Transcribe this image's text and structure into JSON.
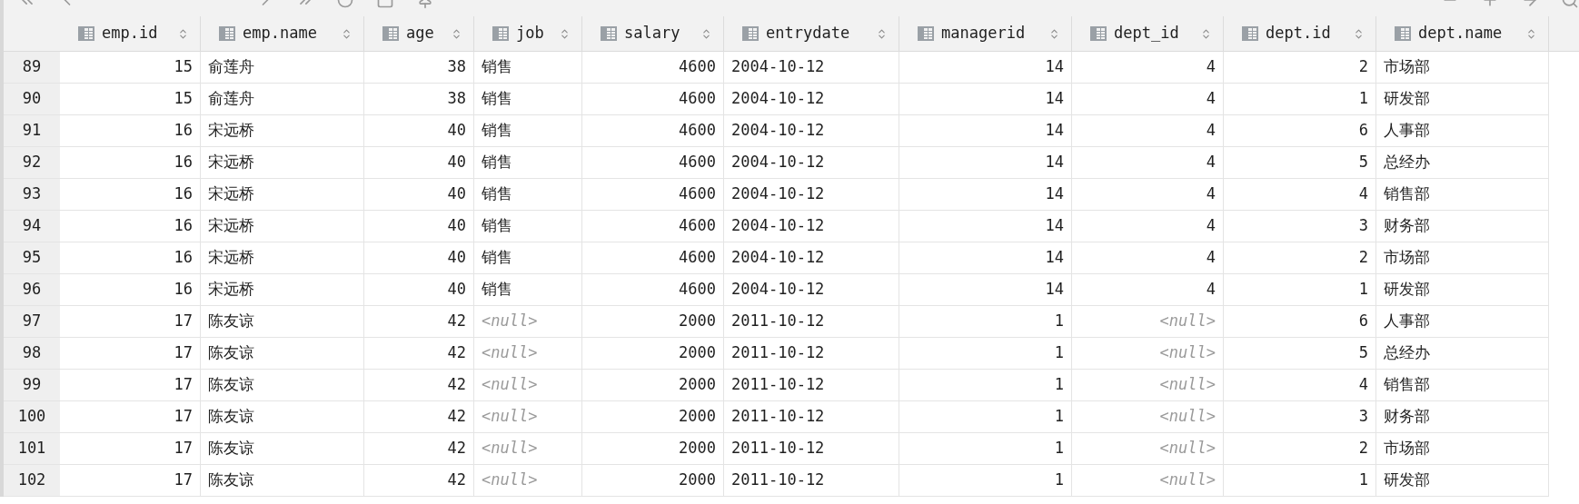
{
  "table": {
    "columns": [
      {
        "name": "emp.id",
        "kind": "number"
      },
      {
        "name": "emp.name",
        "kind": "text"
      },
      {
        "name": "age",
        "kind": "number"
      },
      {
        "name": "job",
        "kind": "text"
      },
      {
        "name": "salary",
        "kind": "number"
      },
      {
        "name": "entrydate",
        "kind": "text"
      },
      {
        "name": "managerid",
        "kind": "number"
      },
      {
        "name": "dept_id",
        "kind": "number"
      },
      {
        "name": "dept.id",
        "kind": "number"
      },
      {
        "name": "dept.name",
        "kind": "text"
      }
    ],
    "rows": [
      {
        "number": "89",
        "cells": [
          "15",
          "俞莲舟",
          "38",
          "销售",
          "4600",
          "2004-10-12",
          "14",
          "4",
          "2",
          "市场部"
        ]
      },
      {
        "number": "90",
        "cells": [
          "15",
          "俞莲舟",
          "38",
          "销售",
          "4600",
          "2004-10-12",
          "14",
          "4",
          "1",
          "研发部"
        ]
      },
      {
        "number": "91",
        "cells": [
          "16",
          "宋远桥",
          "40",
          "销售",
          "4600",
          "2004-10-12",
          "14",
          "4",
          "6",
          "人事部"
        ]
      },
      {
        "number": "92",
        "cells": [
          "16",
          "宋远桥",
          "40",
          "销售",
          "4600",
          "2004-10-12",
          "14",
          "4",
          "5",
          "总经办"
        ]
      },
      {
        "number": "93",
        "cells": [
          "16",
          "宋远桥",
          "40",
          "销售",
          "4600",
          "2004-10-12",
          "14",
          "4",
          "4",
          "销售部"
        ]
      },
      {
        "number": "94",
        "cells": [
          "16",
          "宋远桥",
          "40",
          "销售",
          "4600",
          "2004-10-12",
          "14",
          "4",
          "3",
          "财务部"
        ]
      },
      {
        "number": "95",
        "cells": [
          "16",
          "宋远桥",
          "40",
          "销售",
          "4600",
          "2004-10-12",
          "14",
          "4",
          "2",
          "市场部"
        ]
      },
      {
        "number": "96",
        "cells": [
          "16",
          "宋远桥",
          "40",
          "销售",
          "4600",
          "2004-10-12",
          "14",
          "4",
          "1",
          "研发部"
        ]
      },
      {
        "number": "97",
        "cells": [
          "17",
          "陈友谅",
          "42",
          {
            "text": "<null>",
            "kind": "null"
          },
          "2000",
          "2011-10-12",
          "1",
          {
            "text": "<null>",
            "kind": "null"
          },
          "6",
          "人事部"
        ]
      },
      {
        "number": "98",
        "cells": [
          "17",
          "陈友谅",
          "42",
          {
            "text": "<null>",
            "kind": "null"
          },
          "2000",
          "2011-10-12",
          "1",
          {
            "text": "<null>",
            "kind": "null"
          },
          "5",
          "总经办"
        ]
      },
      {
        "number": "99",
        "cells": [
          "17",
          "陈友谅",
          "42",
          {
            "text": "<null>",
            "kind": "null"
          },
          "2000",
          "2011-10-12",
          "1",
          {
            "text": "<null>",
            "kind": "null"
          },
          "4",
          "销售部"
        ]
      },
      {
        "number": "100",
        "cells": [
          "17",
          "陈友谅",
          "42",
          {
            "text": "<null>",
            "kind": "null"
          },
          "2000",
          "2011-10-12",
          "1",
          {
            "text": "<null>",
            "kind": "null"
          },
          "3",
          "财务部"
        ]
      },
      {
        "number": "101",
        "cells": [
          "17",
          "陈友谅",
          "42",
          {
            "text": "<null>",
            "kind": "null"
          },
          "2000",
          "2011-10-12",
          "1",
          {
            "text": "<null>",
            "kind": "null"
          },
          "2",
          "市场部"
        ]
      },
      {
        "number": "102",
        "cells": [
          "17",
          "陈友谅",
          "42",
          {
            "text": "<null>",
            "kind": "null"
          },
          "2000",
          "2011-10-12",
          "1",
          {
            "text": "<null>",
            "kind": "null"
          },
          "1",
          "研发部"
        ]
      }
    ]
  }
}
